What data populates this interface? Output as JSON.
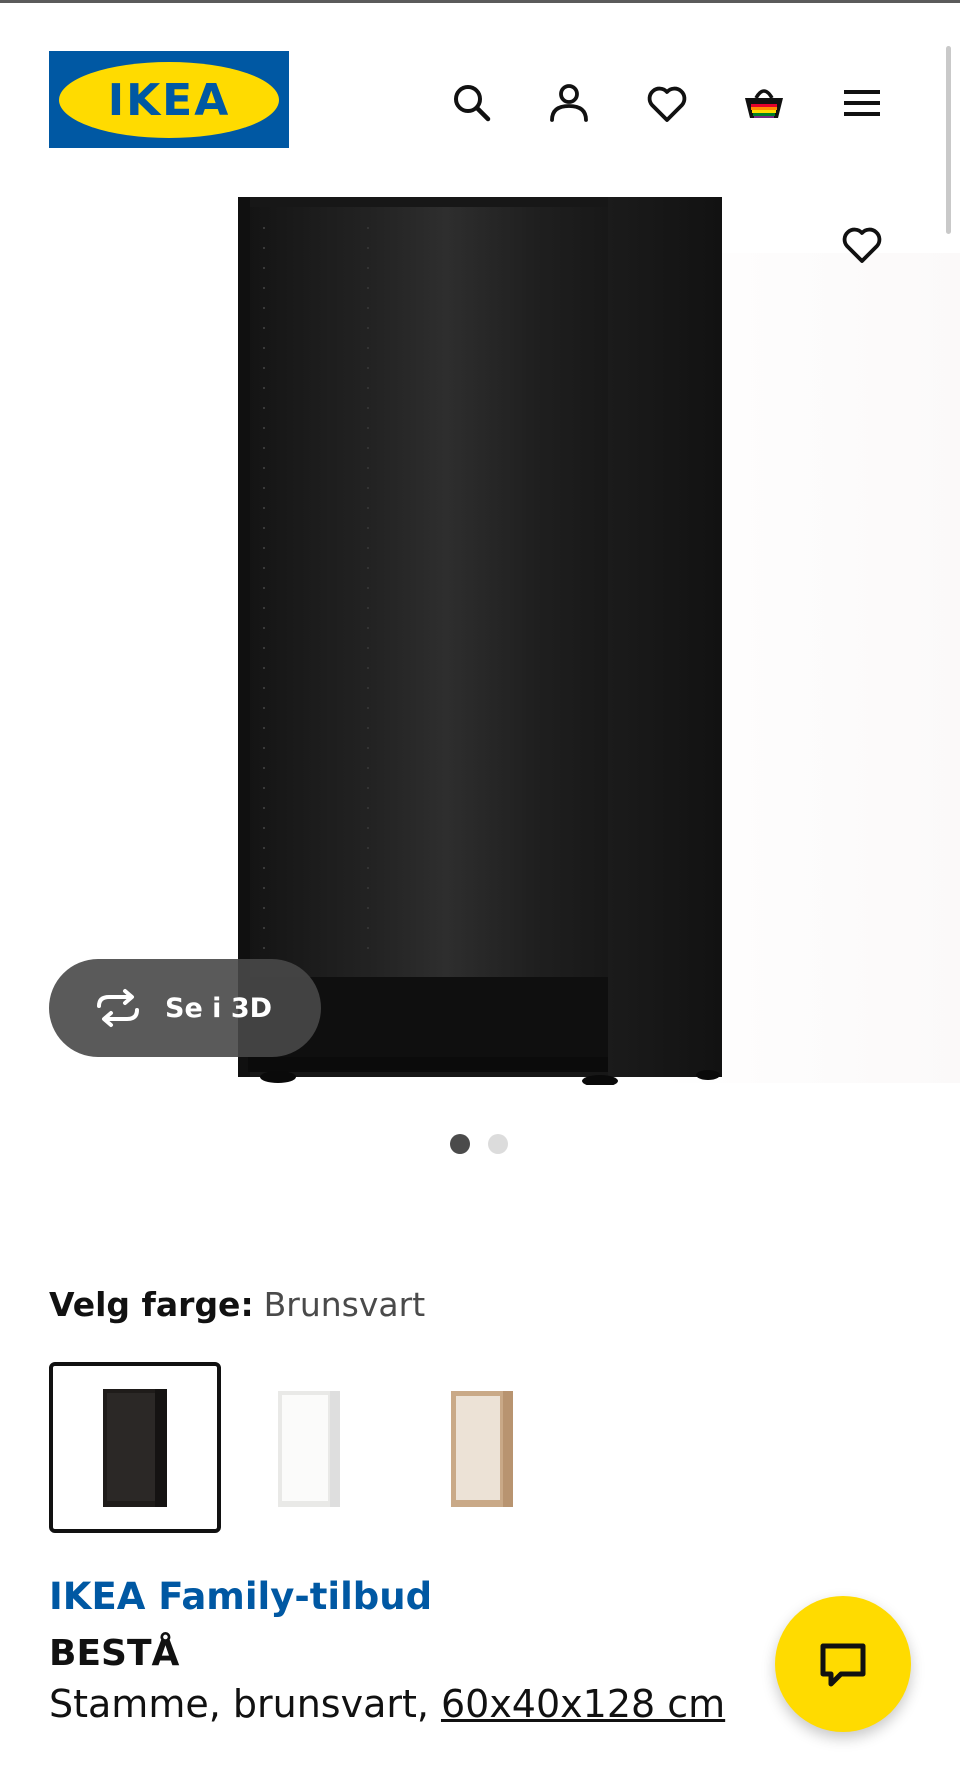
{
  "header": {
    "logo_text": "IKEA",
    "icons": [
      "search-icon",
      "user-icon",
      "heart-icon",
      "cart-icon",
      "menu-icon"
    ]
  },
  "gallery": {
    "favorite_icon": "heart-icon",
    "view_3d_label": "Se i 3D",
    "view_3d_icon": "rotate-3d-icon",
    "slide_count": 2,
    "active_slide": 1
  },
  "product": {
    "color_label": "Velg farge:",
    "color_value": "Brunsvart",
    "swatches": [
      {
        "name": "brunsvart",
        "selected": true,
        "color": "#1f1c1a"
      },
      {
        "name": "white",
        "selected": false,
        "color": "#f7f7f5"
      },
      {
        "name": "white-stained-oak",
        "selected": false,
        "color": "#d9bea0"
      }
    ],
    "family_offer": "IKEA Family-tilbud",
    "name": "BESTÅ",
    "description": "Stamme, brunsvart,",
    "dimensions": "60x40x128 cm"
  },
  "chat": {
    "icon": "chat-bubble-icon"
  },
  "colors": {
    "ikea_blue": "#0058a3",
    "ikea_yellow": "#ffdb00",
    "family_blue": "#0058a3"
  }
}
